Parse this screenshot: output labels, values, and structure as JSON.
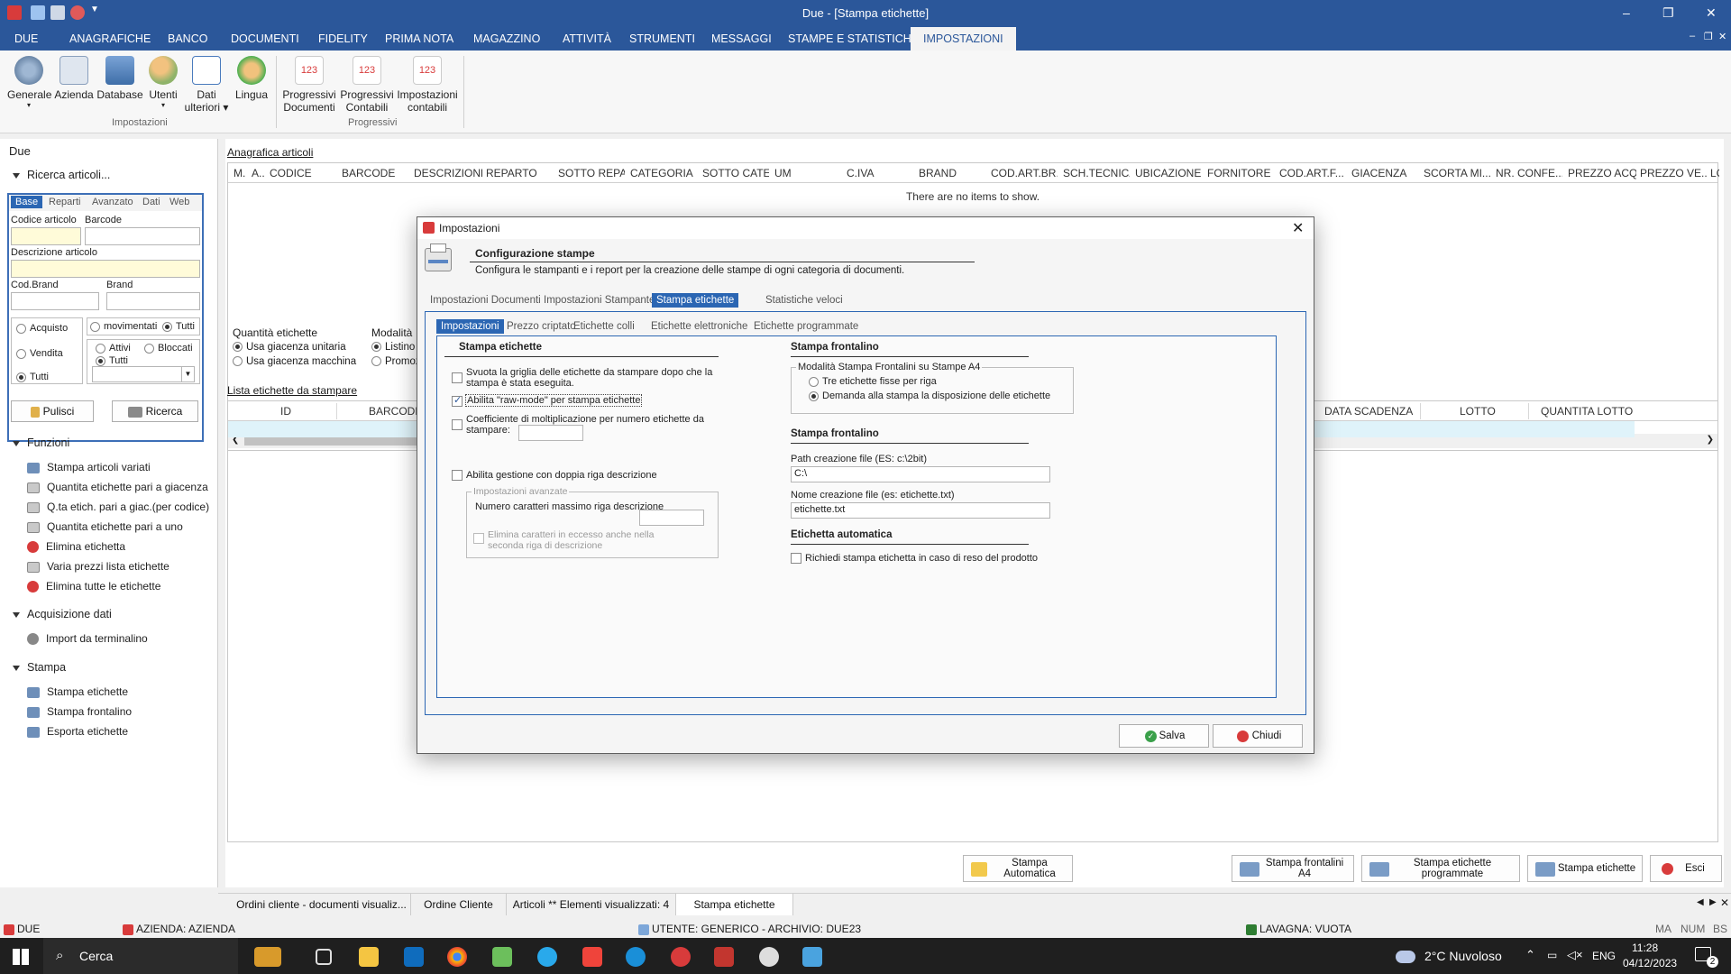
{
  "window": {
    "title": "Due - [Stampa etichette]"
  },
  "menu": [
    "DUE",
    "ANAGRAFICHE",
    "BANCO",
    "DOCUMENTI",
    "FIDELITY",
    "PRIMA NOTA",
    "MAGAZZINO",
    "ATTIVITÀ",
    "STRUMENTI",
    "MESSAGGI",
    "STAMPE E STATISTICHE",
    "IMPOSTAZIONI"
  ],
  "ribbon": {
    "buttons": [
      {
        "label": "Generale",
        "sub": "▾",
        "icon": "gear-icon"
      },
      {
        "label": "Azienda",
        "icon": "company-icon"
      },
      {
        "label": "Database",
        "icon": "database-icon"
      },
      {
        "label": "Utenti",
        "sub": "▾",
        "icon": "users-icon"
      },
      {
        "label": "Dati",
        "sub": "ulteriori ▾",
        "icon": "data-icon"
      },
      {
        "label": "Lingua",
        "icon": "language-icon"
      },
      {
        "label": "Progressivi",
        "sub": "Documenti",
        "icon": "counter-icon",
        "num": "123"
      },
      {
        "label": "Progressivi",
        "sub": "Contabili",
        "icon": "counter-icon",
        "num": "123"
      },
      {
        "label": "Impostazioni",
        "sub": "contabili",
        "icon": "counter-icon",
        "num": "123"
      }
    ],
    "groups": [
      "Impostazioni",
      "Progressivi"
    ]
  },
  "left": {
    "header": "Due",
    "search_section": "Ricerca articoli...",
    "search_tabs": [
      "Base",
      "Reparti",
      "Avanzato",
      "Dati",
      "Web"
    ],
    "labels": {
      "codice": "Codice articolo",
      "barcode": "Barcode",
      "descrizione": "Descrizione articolo",
      "codbrand": "Cod.Brand",
      "brand": "Brand"
    },
    "radios1": [
      "Acquisto",
      "Vendita",
      "Tutti"
    ],
    "radios2": [
      "movimentati",
      "Tutti"
    ],
    "radios3": [
      "Attivi",
      "Bloccati",
      "Tutti"
    ],
    "btn_pulisci": "Pulisci",
    "btn_ricerca": "Ricerca",
    "funzioni_title": "Funzioni",
    "funzioni": [
      "Stampa articoli variati",
      "Quantita etichette pari a giacenza",
      "Q.ta etich. pari a giac.(per codice)",
      "Quantita etichette pari a uno",
      "Elimina etichetta",
      "Varia prezzi lista etichette",
      "Elimina tutte le etichette"
    ],
    "acq_title": "Acquisizione dati",
    "acq_items": [
      "Import da terminalino"
    ],
    "stampa_title": "Stampa",
    "stampa_items": [
      "Stampa etichette",
      "Stampa frontalino",
      "Esporta etichette"
    ]
  },
  "main": {
    "anagrafica_title": "Anagrafica articoli",
    "columns": [
      "M.",
      "A..",
      "CODICE",
      "BARCODE",
      "DESCRIZIONE",
      "REPARTO",
      "SOTTO REPA...",
      "CATEGORIA",
      "SOTTO CATE...",
      "UM",
      "C.IVA",
      "BRAND",
      "COD.ART.BR...",
      "SCH.TECNICA",
      "UBICAZIONE",
      "FORNITORE",
      "COD.ART.F...",
      "GIACENZA",
      "SCORTA MI...",
      "NR. CONFE...",
      "PREZZO ACQ.",
      "PREZZO VE...",
      "LC"
    ],
    "empty_text": "There are no items to show.",
    "qty_title": "Quantità etichette",
    "qty_opts": [
      "Usa giacenza unitaria",
      "Usa giacenza macchina"
    ],
    "mod_title": "Modalità",
    "mod_opts": [
      "Listino",
      "Promoz"
    ],
    "lista_title": "Lista etichette da stampare",
    "lista_cols": [
      "ID",
      "BARCODE",
      "DATA SCADENZA",
      "LOTTO",
      "QUANTITA LOTTO"
    ]
  },
  "bottom_buttons": [
    {
      "label": "Stampa",
      "sub": "Automatica"
    },
    {
      "label": "Stampa frontalini",
      "sub": "A4"
    },
    {
      "label": "Stampa etichette",
      "sub": "programmate"
    },
    {
      "label": "Stampa etichette",
      "sub": ""
    },
    {
      "label": "Esci",
      "sub": ""
    }
  ],
  "doc_tabs": [
    "Ordini cliente - documenti visualiz...",
    "Ordine Cliente",
    "Articoli ** Elementi visualizzati: 4",
    "Stampa etichette"
  ],
  "status": {
    "app": "DUE",
    "azienda": "AZIENDA: AZIENDA",
    "utente": "UTENTE: GENERICO - ARCHIVIO: DUE23",
    "lavagna": "LAVAGNA: VUOTA",
    "keys": [
      "MA",
      "NUM",
      "BS"
    ]
  },
  "taskbar": {
    "search": "Cerca",
    "weather": "2°C  Nuvoloso",
    "lang": "ENG",
    "time": "11:28",
    "date": "04/12/2023",
    "badge": "2"
  },
  "dialog": {
    "title": "Impostazioni",
    "header_title": "Configurazione stampe",
    "header_desc": "Configura le stampanti e i report per la creazione delle stampe di ogni categoria di documenti.",
    "tabs": [
      "Impostazioni Documenti",
      "Impostazioni Stampante",
      "Stampa etichette",
      "Statistiche veloci"
    ],
    "subtabs": [
      "Impostazioni",
      "Prezzo criptato",
      "Etichette colli",
      "Etichette elettroniche",
      "Etichette programmate"
    ],
    "left_section": "Stampa etichette",
    "chk_svuota": "Svuota la griglia delle etichette da stampare dopo che la stampa è stata eseguita.",
    "chk_raw": "Abilita \"raw-mode\" per stampa etichette",
    "chk_coeff": "Coefficiente di moltiplicazione per numero etichette da stampare:",
    "chk_doppia": "Abilita gestione con doppia riga descrizione",
    "adv_title": "Impostazioni avanzate",
    "adv_num": "Numero caratteri massimo riga descrizione",
    "adv_elimina": "Elimina caratteri in eccesso anche nella seconda riga di descrizione",
    "right_section1": "Stampa frontalino",
    "mod_group": "Modalità Stampa Frontalini su Stampe A4",
    "mod_opt1": "Tre etichette fisse per riga",
    "mod_opt2": "Demanda alla stampa la disposizione delle etichette",
    "right_section2": "Stampa frontalino",
    "path_label": "Path creazione file (ES: c:\\2bit)",
    "path_value": "C:\\",
    "name_label": "Nome creazione file (es: etichette.txt)",
    "name_value": "etichette.txt",
    "right_section3": "Etichetta automatica",
    "chk_auto": "Richiedi stampa etichetta in caso di reso del prodotto",
    "btn_salva": "Salva",
    "btn_chiudi": "Chiudi"
  },
  "colors": {
    "accent": "#2b579a",
    "tab_active": "#2b66b3",
    "ribbon_num": "#d83b3b"
  }
}
